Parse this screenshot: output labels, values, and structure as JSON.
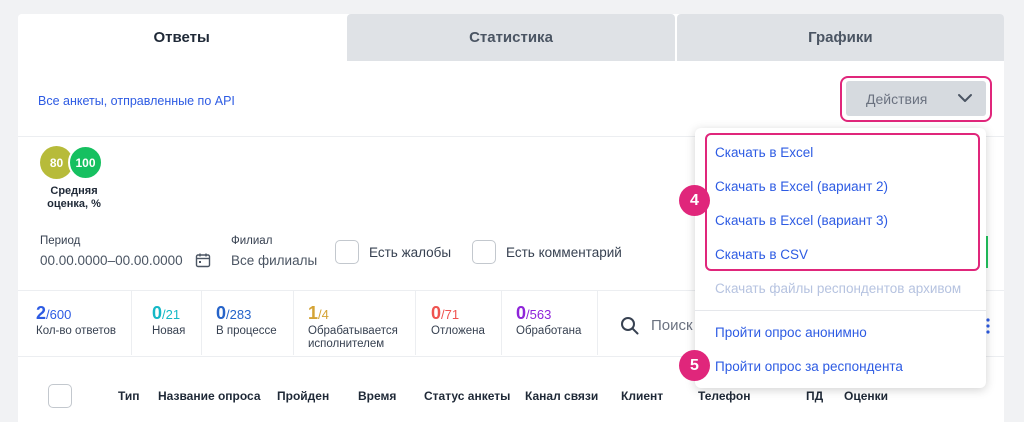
{
  "tabs": [
    {
      "label": "Ответы",
      "active": true
    },
    {
      "label": "Статистика",
      "active": false
    },
    {
      "label": "Графики",
      "active": false
    }
  ],
  "api_link": "Все анкеты, отправленные по API",
  "actions": {
    "label": "Действия",
    "icon": "chevron-down-icon"
  },
  "scores": {
    "first": "80",
    "second": "100",
    "label": "Средняя оценка, %"
  },
  "filters": {
    "period_label": "Период",
    "period_value": "00.00.0000–00.00.0000",
    "branch_label": "Филиал",
    "branch_value": "Все филиалы",
    "complaints": "Есть жалобы",
    "comments": "Есть комментарий"
  },
  "stats": [
    {
      "num": "2",
      "total": "/600",
      "label": "Кол-во ответов",
      "color": "#2d5be3"
    },
    {
      "num": "0",
      "total": "/21",
      "label": "Новая",
      "color": "#14b8c6"
    },
    {
      "num": "0",
      "total": "/283",
      "label": "В процессе",
      "color": "#2563c9"
    },
    {
      "num": "1",
      "total": "/4",
      "label": "Обрабатывается исполнителем",
      "color": "#d4a335"
    },
    {
      "num": "0",
      "total": "/71",
      "label": "Отложена",
      "color": "#ef5350"
    },
    {
      "num": "0",
      "total": "/563",
      "label": "Обработана",
      "color": "#8e24d9"
    }
  ],
  "search_placeholder": "Поиск",
  "table_headers": [
    "Тип",
    "Название опроса",
    "Пройден",
    "Время",
    "Статус анкеты",
    "Канал связи",
    "Клиент",
    "Телефон",
    "ПД",
    "Оценки"
  ],
  "dropdown": {
    "items": [
      {
        "label": "Скачать в Excel",
        "disabled": false
      },
      {
        "label": "Скачать в Excel (вариант 2)",
        "disabled": false
      },
      {
        "label": "Скачать в Excel (вариант 3)",
        "disabled": false
      },
      {
        "label": "Скачать в CSV",
        "disabled": false
      },
      {
        "label": "Скачать файлы респондентов архивом",
        "disabled": true
      },
      {
        "label": "Пройти опрос анонимно",
        "disabled": false
      },
      {
        "label": "Пройти опрос за респондента",
        "disabled": false
      }
    ]
  },
  "badges": {
    "four": "4",
    "five": "5"
  },
  "colors": {
    "accent": "#2d5be3",
    "highlight": "#e0267b"
  }
}
